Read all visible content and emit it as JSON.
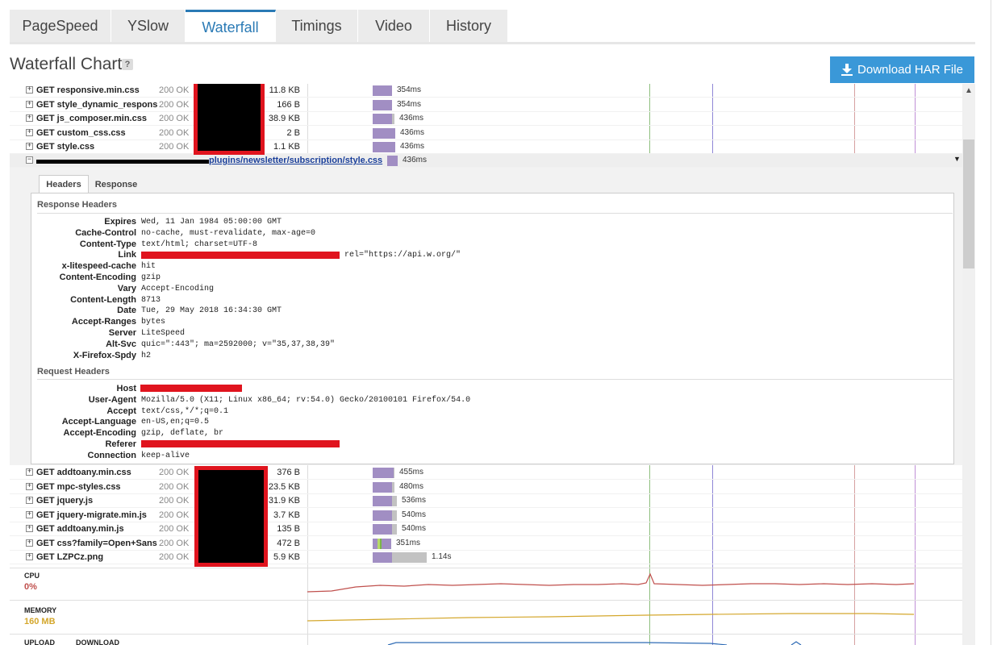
{
  "tabs": [
    "PageSpeed",
    "YSlow",
    "Waterfall",
    "Timings",
    "Video",
    "History"
  ],
  "active_tab": "Waterfall",
  "title": "Waterfall Chart",
  "help_label": "?",
  "download_label": "Download HAR File",
  "rows_top": [
    {
      "url": "GET responsive.min.css",
      "status": "200 OK",
      "size": "11.8 KB",
      "time": "354ms",
      "fill": 0.53,
      "wait": 0.0
    },
    {
      "url": "GET style_dynamic_responsive.css",
      "status": "200 OK",
      "size": "166 B",
      "time": "354ms",
      "fill": 0.53,
      "wait": 0.0
    },
    {
      "url": "GET js_composer.min.css",
      "status": "200 OK",
      "size": "38.9 KB",
      "time": "436ms",
      "fill": 0.53,
      "wait": 0.07
    },
    {
      "url": "GET custom_css.css",
      "status": "200 OK",
      "size": "2 B",
      "time": "436ms",
      "fill": 0.6,
      "wait": 0.0
    },
    {
      "url": "GET style.css",
      "status": "200 OK",
      "size": "1.1 KB",
      "time": "436ms",
      "fill": 0.6,
      "wait": 0.0
    }
  ],
  "expanded_row": {
    "url_tail": "plugins/newsletter/subscription/style.css",
    "time": "436ms",
    "expand_symbol": "−"
  },
  "detail_tabs": [
    "Headers",
    "Response"
  ],
  "response_headers_title": "Response Headers",
  "response_headers": [
    {
      "name": "Expires",
      "value": "Wed, 11 Jan 1984 05:00:00 GMT"
    },
    {
      "name": "Cache-Control",
      "value": "no-cache, must-revalidate, max-age=0"
    },
    {
      "name": "Content-Type",
      "value": "text/html; charset=UTF-8"
    },
    {
      "name": "Link",
      "value": "rel=\"https://api.w.org/\""
    },
    {
      "name": "x-litespeed-cache",
      "value": "hit"
    },
    {
      "name": "Content-Encoding",
      "value": "gzip"
    },
    {
      "name": "Vary",
      "value": "Accept-Encoding"
    },
    {
      "name": "Content-Length",
      "value": "8713"
    },
    {
      "name": "Date",
      "value": "Tue, 29 May 2018 16:34:30 GMT"
    },
    {
      "name": "Accept-Ranges",
      "value": "bytes"
    },
    {
      "name": "Server",
      "value": "LiteSpeed"
    },
    {
      "name": "Alt-Svc",
      "value": "quic=\":443\"; ma=2592000; v=\"35,37,38,39\""
    },
    {
      "name": "X-Firefox-Spdy",
      "value": "h2"
    }
  ],
  "request_headers_title": "Request Headers",
  "request_headers": [
    {
      "name": "Host",
      "value": ""
    },
    {
      "name": "User-Agent",
      "value": "Mozilla/5.0 (X11; Linux x86_64; rv:54.0) Gecko/20100101 Firefox/54.0"
    },
    {
      "name": "Accept",
      "value": "text/css,*/*;q=0.1"
    },
    {
      "name": "Accept-Language",
      "value": "en-US,en;q=0.5"
    },
    {
      "name": "Accept-Encoding",
      "value": "gzip, deflate, br"
    },
    {
      "name": "Referer",
      "value": ""
    },
    {
      "name": "Connection",
      "value": "keep-alive"
    }
  ],
  "rows_bottom": [
    {
      "url": "GET addtoany.min.css",
      "status": "200 OK",
      "size": "376 B",
      "time": "455ms",
      "fill": 0.56,
      "wait": 0.03
    },
    {
      "url": "GET mpc-styles.css",
      "status": "200 OK",
      "size": "23.5 KB",
      "time": "480ms",
      "fill": 0.53,
      "wait": 0.07
    },
    {
      "url": "GET jquery.js",
      "status": "200 OK",
      "size": "31.9 KB",
      "time": "536ms",
      "fill": 0.53,
      "wait": 0.13
    },
    {
      "url": "GET jquery-migrate.min.js",
      "status": "200 OK",
      "size": "3.7 KB",
      "time": "540ms",
      "fill": 0.53,
      "wait": 0.13
    },
    {
      "url": "GET addtoany.min.js",
      "status": "200 OK",
      "size": "135 B",
      "time": "540ms",
      "fill": 0.53,
      "wait": 0.13
    },
    {
      "url": "GET css?family=Open+Sans",
      "status": "200 OK",
      "size": "472 B",
      "time": "351ms",
      "fill": 0.5,
      "wait": 0.0
    },
    {
      "url": "GET LZPCz.png",
      "status": "200 OK",
      "size": "5.9 KB",
      "time": "1.14s",
      "fill": 0.53,
      "wait": 0.93
    }
  ],
  "metrics": {
    "cpu_label": "CPU",
    "cpu_value": "0%",
    "cpu_color": "#c0504d",
    "memory_label": "MEMORY",
    "memory_value": "160 MB",
    "memory_color": "#d4a72c",
    "upload_label": "UPLOAD",
    "download_label": "DOWNLOAD",
    "net_color": "#2e6bb5"
  },
  "colors": {
    "accent": "#2a7ab5",
    "button": "#3a98d8",
    "bar": "#a18ec3",
    "wait": "#c2c2c2",
    "redact": "#e0141e"
  }
}
